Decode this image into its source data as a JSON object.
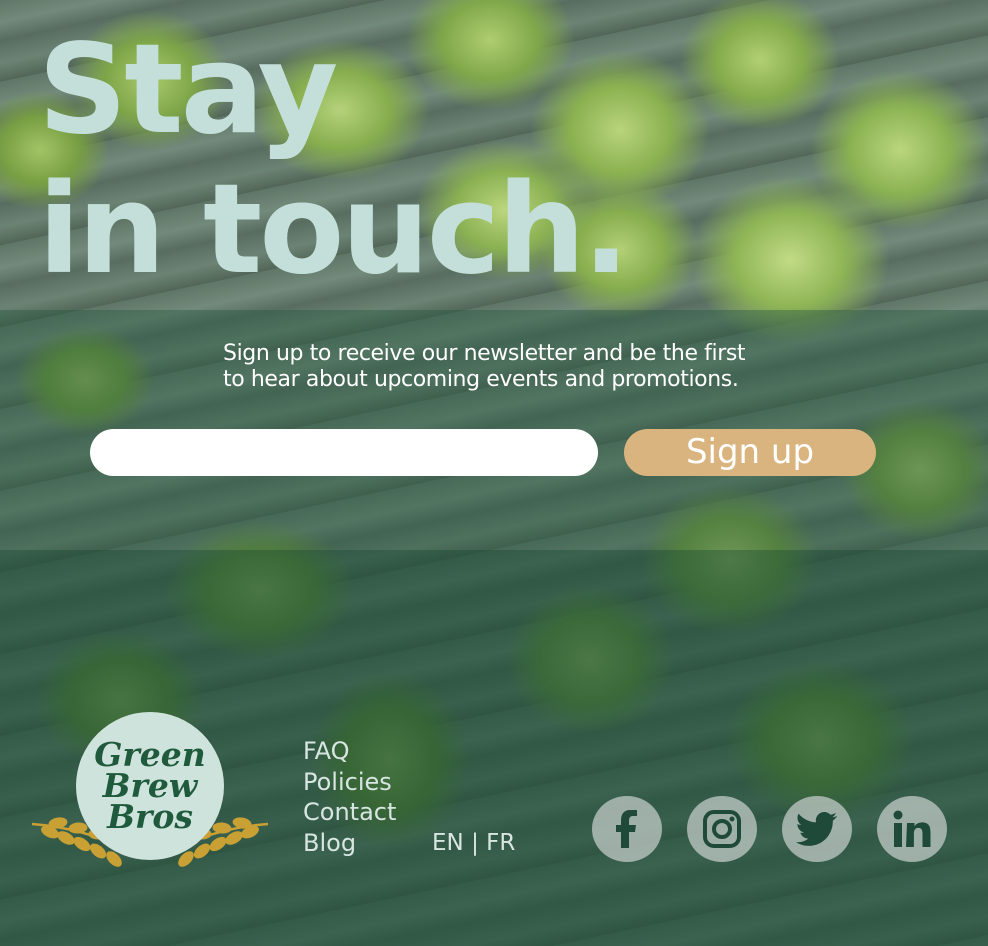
{
  "headline": {
    "line1": "Stay",
    "line2": "in touch."
  },
  "newsletter": {
    "line1": "Sign up to receive our newsletter and be the first",
    "line2": "to hear about upcoming events and promotions.",
    "email_value": "",
    "button_label": "Sign up"
  },
  "logo": {
    "line1": "Green",
    "line2": "Brew",
    "line3": "Bros"
  },
  "footer": {
    "links": [
      "FAQ",
      "Policies",
      "Contact",
      "Blog"
    ],
    "lang": {
      "en": "EN",
      "sep": "|",
      "fr": "FR"
    },
    "socials": [
      "facebook-icon",
      "instagram-icon",
      "twitter-icon",
      "linkedin-icon"
    ]
  },
  "colors": {
    "headline": "#c4dfda",
    "button": "#d9b47f",
    "footer_overlay": "#1a4a36",
    "logo_circle": "#cfe3dd",
    "logo_text": "#1f5a3c",
    "wheat": "#c9a034"
  }
}
